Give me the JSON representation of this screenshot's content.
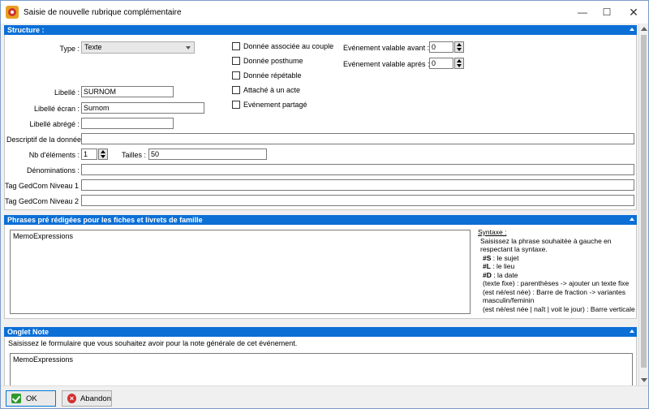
{
  "window": {
    "title": "Saisie de nouvelle rubrique complémentaire"
  },
  "structure": {
    "title": "Structure :",
    "type_label": "Type :",
    "type_value": "Texte",
    "libelle_label": "Libellé :",
    "libelle_value": "SURNOM",
    "libelle_ecran_label": "Libellé écran :",
    "libelle_ecran_value": "Surnom",
    "libelle_abrege_label": "Libellé abrégé :",
    "libelle_abrege_value": "",
    "descriptif_label": "Descriptif de la donnée :",
    "descriptif_value": "",
    "nb_elements_label": "Nb d'éléments :",
    "nb_elements_value": "1",
    "tailles_label": "Tailles :",
    "tailles_value": "50",
    "denominations_label": "Dénominations :",
    "denominations_value": "",
    "tag1_label": "Tag GedCom Niveau 1 :",
    "tag1_value": "",
    "tag2_label": "Tag GedCom Niveau 2 :",
    "tag2_value": "",
    "checkboxes": [
      "Donnée associée au couple",
      "Donnée posthume",
      "Donnée répétable",
      "Attaché à un acte",
      "Evénement partagé"
    ],
    "avant_label": "Evénement valable avant :",
    "avant_value": "0",
    "apres_label": "Evénement valable aprés :",
    "apres_value": "0"
  },
  "phrases": {
    "title": "Phrases pré rédigées pour les fiches et livrets de famille",
    "memo": "MemoExpressions",
    "syntax_title": "Syntaxe :",
    "syntax_intro": "Saisissez la phrase souhaitée à gauche en respectant la syntaxe.",
    "s_code": "#S",
    "s_text": ": le sujet",
    "l_code": "#L",
    "l_text": ": le lieu",
    "d_code": "#D",
    "d_text": ": la date",
    "paren_code": "(texte fixe)",
    "paren_text": ": parenthèses -> ajouter un texte fixe",
    "slash_code": "(est né/est née)",
    "slash_text": ": Barre de fraction -> variantes masculin/feminin",
    "bar_text": "(est né/est née | naît | voit le jour) : Barre verticale"
  },
  "note": {
    "title": "Onglet Note",
    "instruction": "Saisissez le formulaire que vous souhaitez avoir pour la note générale de cet événement.",
    "memo": "MemoExpressions"
  },
  "buttons": {
    "ok": "OK",
    "abandon": "Abandon"
  },
  "colors": {
    "section": "#0b6fd6",
    "ok_icon": "#2e9a2e",
    "cancel_icon": "#d23030"
  }
}
